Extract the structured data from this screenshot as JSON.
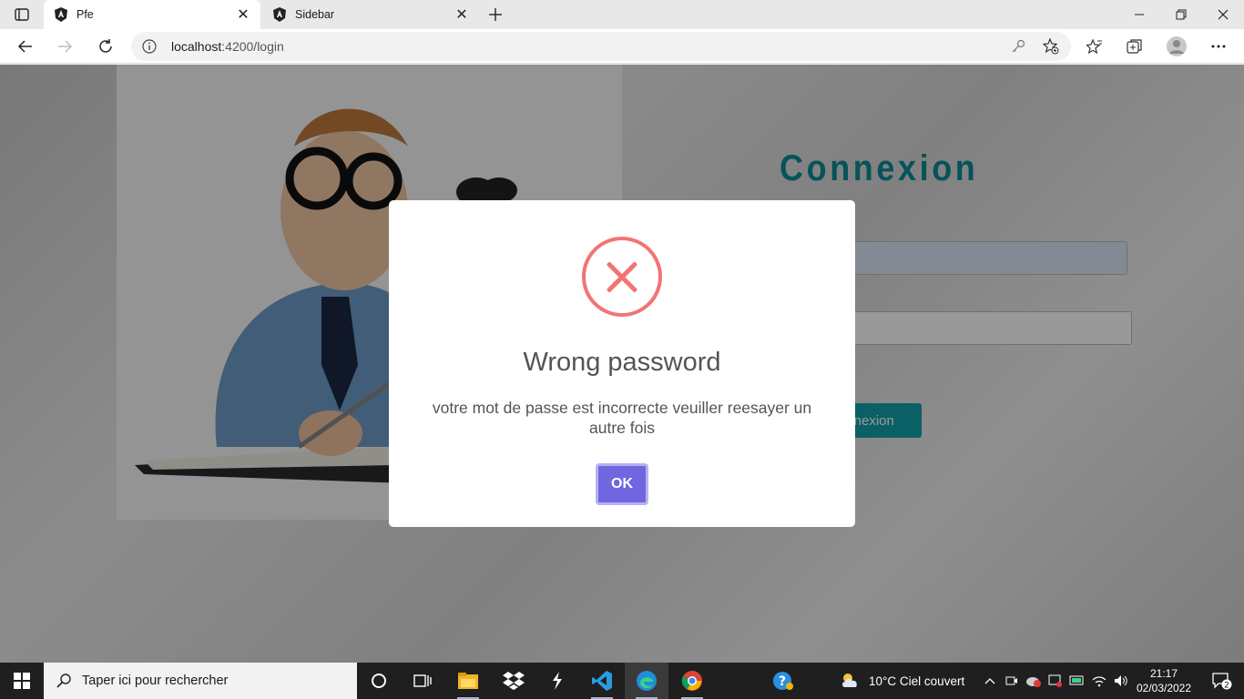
{
  "browser": {
    "tabs": [
      {
        "title": "Pfe",
        "active": true
      },
      {
        "title": "Sidebar",
        "active": false
      }
    ],
    "url_host": "localhost",
    "url_rest": ":4200/login"
  },
  "page": {
    "heading": "Connexion",
    "login_button": "Connexion"
  },
  "dialog": {
    "title": "Wrong password",
    "message": "votre mot de passe est incorrecte veuiller reesayer un autre fois",
    "ok_label": "OK",
    "icon_color": "#f27474",
    "button_color": "#7066e0"
  },
  "taskbar": {
    "search_placeholder": "Taper ici pour rechercher",
    "weather": "10°C  Ciel couvert",
    "time": "21:17",
    "date": "02/03/2022",
    "notifications": "2"
  }
}
